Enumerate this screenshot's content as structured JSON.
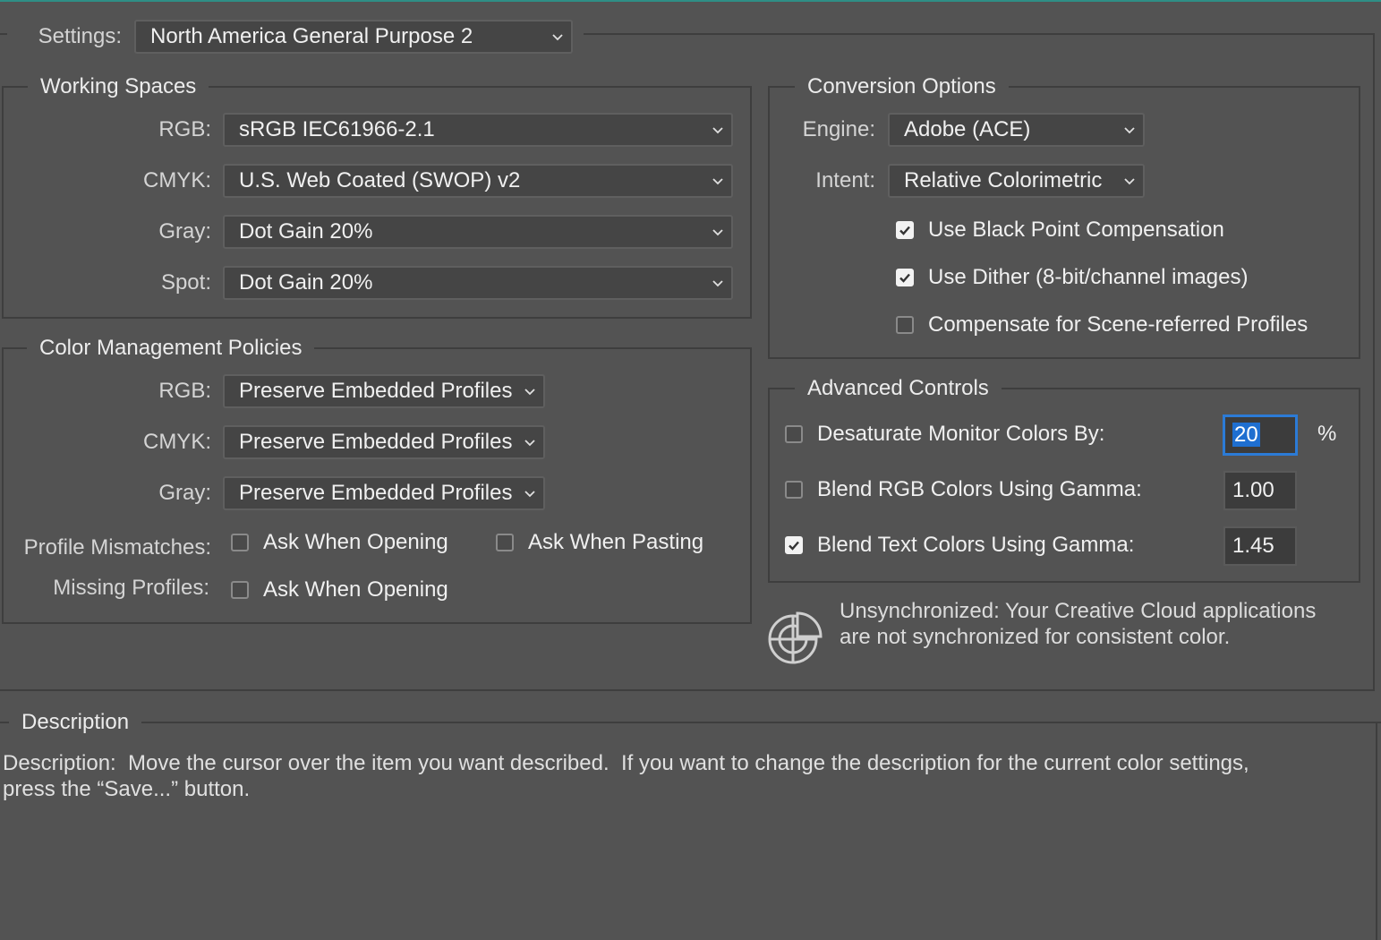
{
  "settings": {
    "label": "Settings:",
    "value": "North America General Purpose 2"
  },
  "working_spaces": {
    "title": "Working Spaces",
    "rgb": {
      "label": "RGB:",
      "value": "sRGB IEC61966-2.1"
    },
    "cmyk": {
      "label": "CMYK:",
      "value": "U.S. Web Coated (SWOP) v2"
    },
    "gray": {
      "label": "Gray:",
      "value": "Dot Gain 20%"
    },
    "spot": {
      "label": "Spot:",
      "value": "Dot Gain 20%"
    }
  },
  "policies": {
    "title": "Color Management Policies",
    "rgb": {
      "label": "RGB:",
      "value": "Preserve Embedded Profiles"
    },
    "cmyk": {
      "label": "CMYK:",
      "value": "Preserve Embedded Profiles"
    },
    "gray": {
      "label": "Gray:",
      "value": "Preserve Embedded Profiles"
    },
    "profile_mismatches": {
      "label": "Profile Mismatches:",
      "ask_opening": {
        "label": "Ask When Opening",
        "checked": false
      },
      "ask_pasting": {
        "label": "Ask When Pasting",
        "checked": false
      }
    },
    "missing_profiles": {
      "label": "Missing Profiles:",
      "ask_opening": {
        "label": "Ask When Opening",
        "checked": false
      }
    }
  },
  "conversion": {
    "title": "Conversion Options",
    "engine": {
      "label": "Engine:",
      "value": "Adobe (ACE)"
    },
    "intent": {
      "label": "Intent:",
      "value": "Relative Colorimetric"
    },
    "black_point": {
      "label": "Use Black Point Compensation",
      "checked": true
    },
    "dither": {
      "label": "Use Dither (8-bit/channel images)",
      "checked": true
    },
    "scene_referred": {
      "label": "Compensate for Scene-referred Profiles",
      "checked": false
    }
  },
  "advanced": {
    "title": "Advanced Controls",
    "desaturate": {
      "label": "Desaturate Monitor Colors By:",
      "checked": false,
      "value": "20",
      "unit": "%"
    },
    "blend_rgb": {
      "label": "Blend RGB Colors Using Gamma:",
      "checked": false,
      "value": "1.00"
    },
    "blend_text": {
      "label": "Blend Text Colors Using Gamma:",
      "checked": true,
      "value": "1.45"
    }
  },
  "sync": {
    "icon": "color-sync-icon",
    "line1": "Unsynchronized: Your Creative Cloud applications",
    "line2": "are not synchronized for consistent color."
  },
  "description": {
    "title": "Description",
    "line1": "Description:  Move the cursor over the item you want described.  If you want to change the description for the current color settings,",
    "line2": "press the “Save...” button."
  }
}
